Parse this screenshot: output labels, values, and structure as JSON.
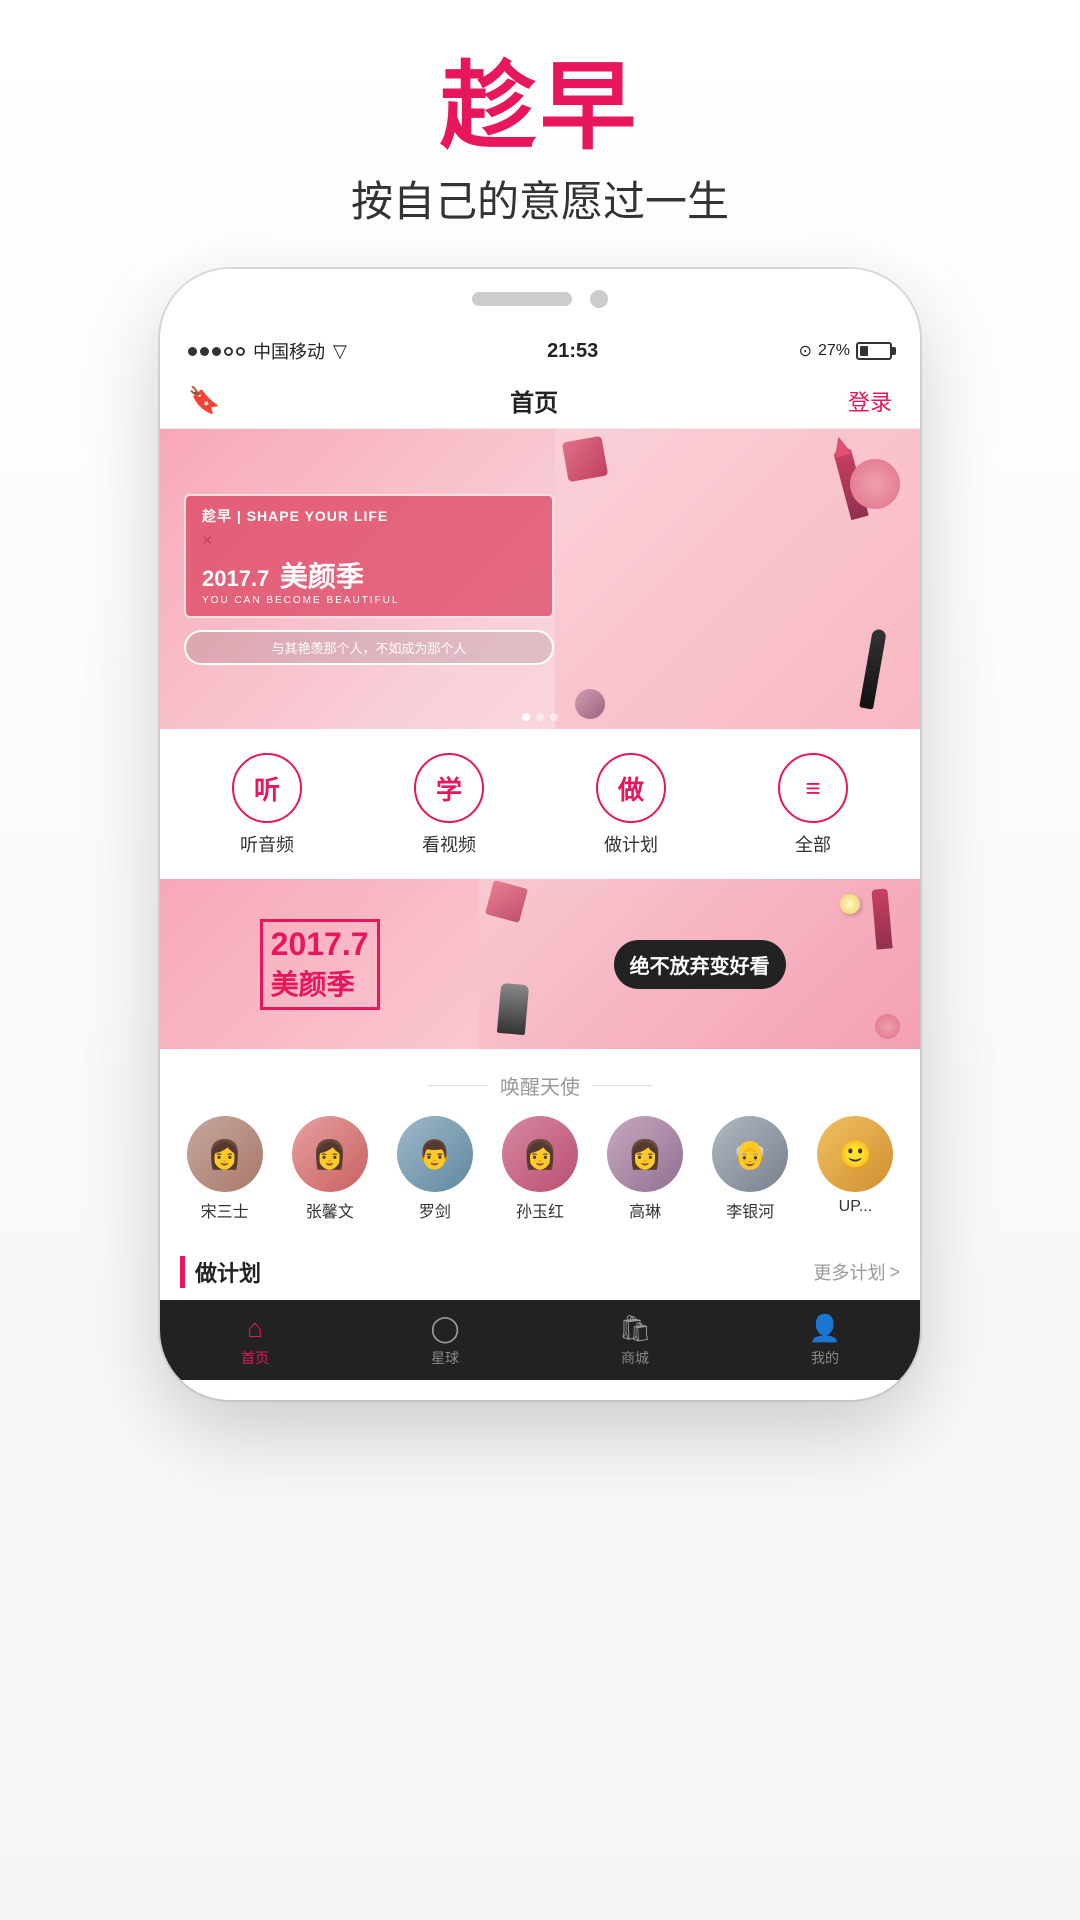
{
  "header": {
    "title_main": "趁早",
    "title_sub": "按自己的意愿过一生"
  },
  "statusBar": {
    "carrier": "中国移动",
    "wifi": "WiFi",
    "time": "21:53",
    "battery_percent": "27%"
  },
  "navBar": {
    "title": "首页",
    "login_label": "登录"
  },
  "banner": {
    "brand": "趁早 | SHAPE YOUR LIFE",
    "cross": "×",
    "year_season": "2017.7 美颜季",
    "sub": "YOU CAN BECOME BEAUTIFUL",
    "tagline": "与其艳羡那个人，不如成为那个人"
  },
  "quickActions": [
    {
      "icon": "听",
      "label": "听音频"
    },
    {
      "icon": "学",
      "label": "看视频"
    },
    {
      "icon": "做",
      "label": "做计划"
    },
    {
      "icon": "≡",
      "label": "全部"
    }
  ],
  "promoBanner": {
    "year": "2017.7",
    "season": "美颜季",
    "slogan": "绝不放弃变好看"
  },
  "ambassadors": {
    "section_title": "唤醒天使",
    "people": [
      {
        "name": "宋三士",
        "avatar_color": "av1"
      },
      {
        "name": "张馨文",
        "avatar_color": "av2"
      },
      {
        "name": "罗剑",
        "avatar_color": "av3"
      },
      {
        "name": "孙玉红",
        "avatar_color": "av4"
      },
      {
        "name": "高琳",
        "avatar_color": "av5"
      },
      {
        "name": "李银河",
        "avatar_color": "av6"
      },
      {
        "name": "UP...",
        "avatar_color": "av7"
      }
    ]
  },
  "plansSection": {
    "title": "做计划",
    "more_label": "更多计划",
    "more_arrow": ">"
  },
  "bottomNav": [
    {
      "icon": "🏠",
      "label": "首页",
      "active": true
    },
    {
      "icon": "○",
      "label": "星球",
      "active": false
    },
    {
      "icon": "🛍",
      "label": "商城",
      "active": false
    },
    {
      "icon": "👤",
      "label": "我的",
      "active": false
    }
  ]
}
